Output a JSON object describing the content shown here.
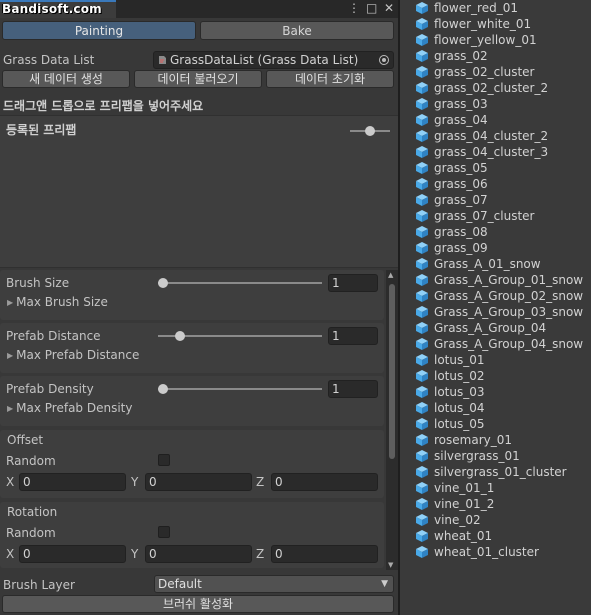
{
  "watermark": "Bandisoft.com",
  "window_controls": {
    "menu": "⋮",
    "maximize": "□",
    "close": "✕"
  },
  "mode_tabs": {
    "painting": "Painting",
    "bake": "Bake"
  },
  "grass_data": {
    "label": "Grass Data List",
    "value": "GrassDataList (Grass Data List)"
  },
  "data_buttons": {
    "new": "새 데이터 생성",
    "load": "데이터 불러오기",
    "reset": "데이터 초기화"
  },
  "drop_hint": "드래그앤 드롭으로 프리팹을 넣어주세요",
  "registered_label": "등록된 프리팹",
  "brush_size": {
    "label": "Brush Size",
    "value": "1",
    "level": 0,
    "foldout": "Max Brush Size"
  },
  "prefab_distance": {
    "label": "Prefab Distance",
    "value": "1",
    "level": 0.11,
    "foldout": "Max Prefab Distance"
  },
  "prefab_density": {
    "label": "Prefab Density",
    "value": "1",
    "level": 0,
    "foldout": "Max Prefab Density"
  },
  "offset": {
    "title": "Offset",
    "random_label": "Random",
    "random_checked": false,
    "x_label": "X",
    "x": "0",
    "y_label": "Y",
    "y": "0",
    "z_label": "Z",
    "z": "0"
  },
  "rotation": {
    "title": "Rotation",
    "random_label": "Random",
    "random_checked": false,
    "x_label": "X",
    "x": "0",
    "y_label": "Y",
    "y": "0",
    "z_label": "Z",
    "z": "0"
  },
  "brush_layer": {
    "label": "Brush Layer",
    "value": "Default"
  },
  "activate_button": "브러쉬 활성화",
  "assets": [
    "flower_red_01",
    "flower_white_01",
    "flower_yellow_01",
    "grass_02",
    "grass_02_cluster",
    "grass_02_cluster_2",
    "grass_03",
    "grass_04",
    "grass_04_cluster_2",
    "grass_04_cluster_3",
    "grass_05",
    "grass_06",
    "grass_07",
    "grass_07_cluster",
    "grass_08",
    "grass_09",
    "Grass_A_01_snow",
    "Grass_A_Group_01_snow",
    "Grass_A_Group_02_snow",
    "Grass_A_Group_03_snow",
    "Grass_A_Group_04",
    "Grass_A_Group_04_snow",
    "lotus_01",
    "lotus_02",
    "lotus_03",
    "lotus_04",
    "lotus_05",
    "rosemary_01",
    "silvergrass_01",
    "silvergrass_01_cluster",
    "vine_01_1",
    "vine_01_2",
    "vine_02",
    "wheat_01",
    "wheat_01_cluster"
  ],
  "colors": {
    "accent": "#3a79bb",
    "active_tab": "#46607c",
    "prefab_cube": "#49a9e8"
  },
  "icons": {
    "asset": "prefab-cube-icon",
    "object_picker": "object-picker-icon",
    "data_asset": "scriptable-object-icon"
  }
}
